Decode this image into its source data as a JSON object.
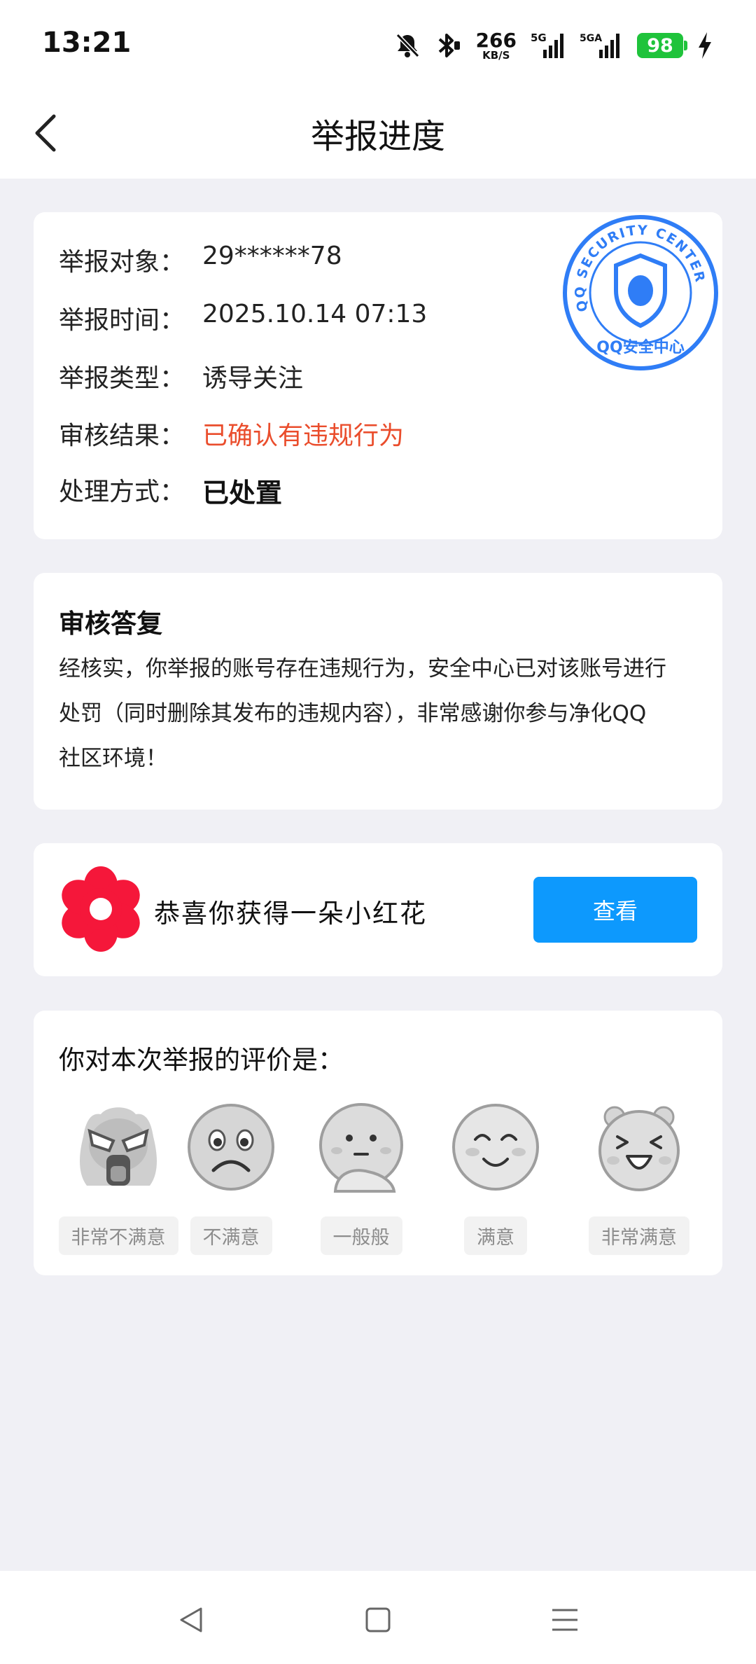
{
  "status_bar": {
    "time": "13:21",
    "speed_value": "266",
    "speed_unit": "KB/S",
    "signal1_label": "5G",
    "signal2_label": "5GA",
    "battery": "98",
    "icons": [
      "bell-muted-icon",
      "bluetooth-icon",
      "signal-icon",
      "charging-icon"
    ]
  },
  "header": {
    "title": "举报进度",
    "back_icon": "chevron-left-icon"
  },
  "report_info": {
    "rows": [
      {
        "label": "举报对象：",
        "value": "29******78"
      },
      {
        "label": "举报时间：",
        "value": "2025.10.14 07:13"
      },
      {
        "label": "举报类型：",
        "value": "诱导关注"
      },
      {
        "label": "审核结果：",
        "value": "已确认有违规行为"
      },
      {
        "label": "处理方式：",
        "value": "已处置"
      }
    ],
    "result_color": "#ea4d2c",
    "stamp": {
      "outer_text": "QQ SECURITY CENTER",
      "inner_text": "QQ安全中心",
      "color": "#2f7df6"
    }
  },
  "reply": {
    "title": "审核答复",
    "line1": "经核实，你举报的账号存在违规行为，安全中心已对该账号进行",
    "line2": "处罚（同时删除其发布的违规内容），非常感谢你参与净化QQ",
    "line3": "社区环境！"
  },
  "reward": {
    "text": "恭喜你获得一朵小红花",
    "button": "查看",
    "flower_color": "#f5173a",
    "button_color": "#0d99fd"
  },
  "rating": {
    "title": "你对本次举报的评价是：",
    "options": [
      {
        "label": "非常不满意",
        "icon": "furious-face-icon"
      },
      {
        "label": "不满意",
        "icon": "sad-face-icon"
      },
      {
        "label": "一般般",
        "icon": "thinking-face-icon"
      },
      {
        "label": "满意",
        "icon": "smile-face-icon"
      },
      {
        "label": "非常满意",
        "icon": "laughing-bear-face-icon"
      }
    ]
  },
  "nav_bar": {
    "icons": [
      "back-triangle-icon",
      "home-square-icon",
      "menu-lines-icon"
    ]
  }
}
